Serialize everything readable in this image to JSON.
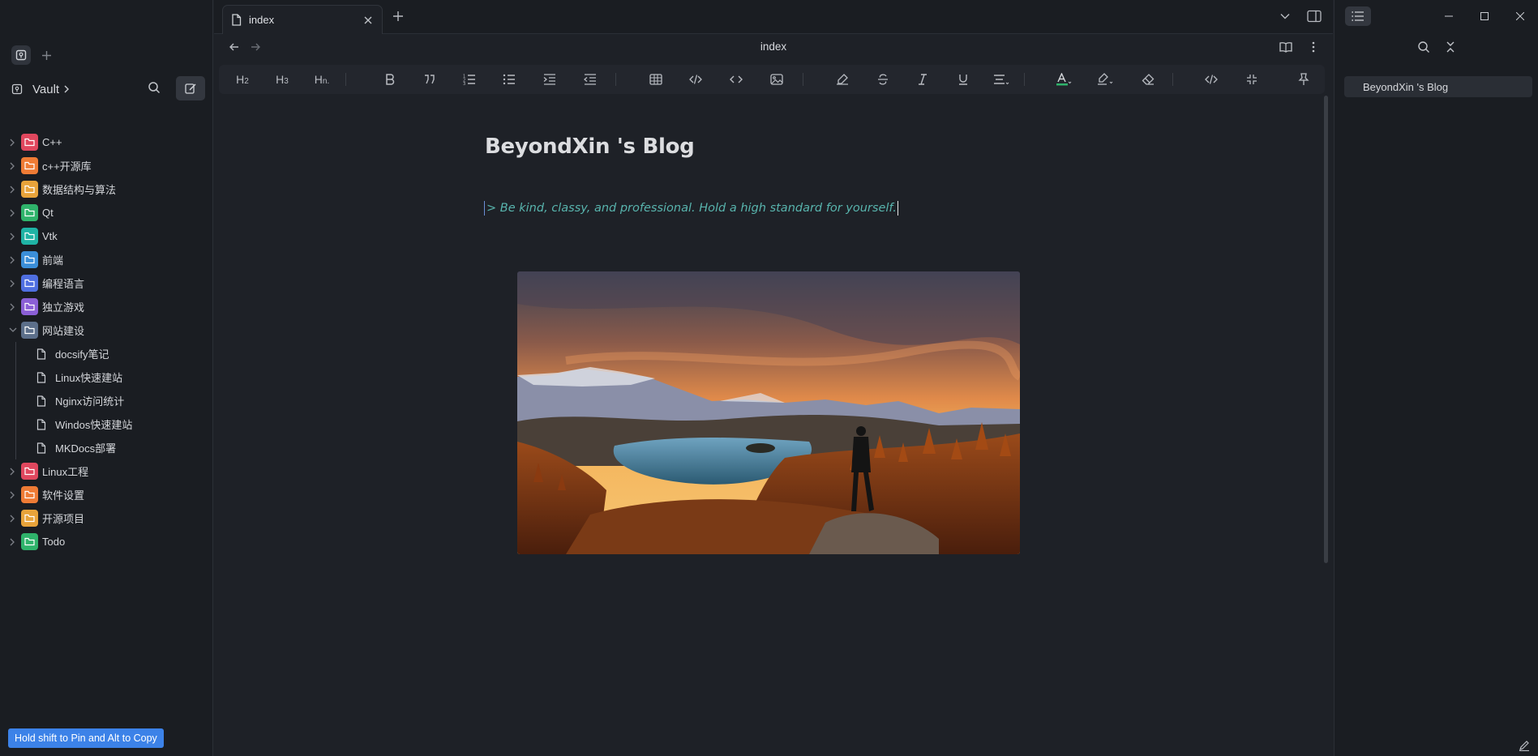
{
  "sidebar": {
    "vault_name": "Vault",
    "tree": [
      {
        "label": "C++",
        "color": "#e0475e",
        "expanded": false
      },
      {
        "label": "c++开源库",
        "color": "#ee7b35",
        "expanded": false
      },
      {
        "label": "数据结构与算法",
        "color": "#e8a33a",
        "expanded": false
      },
      {
        "label": "Qt",
        "color": "#2fb36b",
        "expanded": false
      },
      {
        "label": "Vtk",
        "color": "#1fb3a5",
        "expanded": false
      },
      {
        "label": "前端",
        "color": "#3b8fd9",
        "expanded": false
      },
      {
        "label": "编程语言",
        "color": "#4f6fe0",
        "expanded": false
      },
      {
        "label": "独立游戏",
        "color": "#8b5fd6",
        "expanded": false
      },
      {
        "label": "网站建设",
        "color": "#5c6f8a",
        "expanded": true
      },
      {
        "label": "Linux工程",
        "color": "#e0475e",
        "expanded": false
      },
      {
        "label": "软件设置",
        "color": "#ee7b35",
        "expanded": false
      },
      {
        "label": "开源项目",
        "color": "#e8a33a",
        "expanded": false
      },
      {
        "label": "Todo",
        "color": "#2fb36b",
        "expanded": false
      }
    ],
    "files": [
      "docsify笔记",
      "Linux快速建站",
      "Nginx访问统计",
      "Windos快速建站",
      "MKDocs部署"
    ],
    "toast": "Hold shift to Pin and Alt to Copy"
  },
  "tabs": [
    {
      "label": "index"
    }
  ],
  "nav": {
    "title": "index"
  },
  "toolbar": {
    "items": [
      "H2",
      "H3",
      "Hn",
      "bold",
      "quote",
      "ordered-list",
      "unordered-list",
      "indent",
      "outdent",
      "table",
      "code-block",
      "inline-code",
      "image",
      "clear-format",
      "strikethrough",
      "italic",
      "underline",
      "align",
      "text-color",
      "highlight",
      "eraser",
      "source",
      "collapse",
      "pin"
    ]
  },
  "document": {
    "title": "BeyondXin 's Blog",
    "quote_marker": ">",
    "quote": "Be kind, classy, and professional. Hold a high standard for yourself."
  },
  "outline": {
    "items": [
      "BeyondXin 's Blog"
    ]
  },
  "colors": {
    "accent": "#3c82e8",
    "quote_text": "#58b4ad",
    "text_color_underline": "#2fb36b"
  }
}
